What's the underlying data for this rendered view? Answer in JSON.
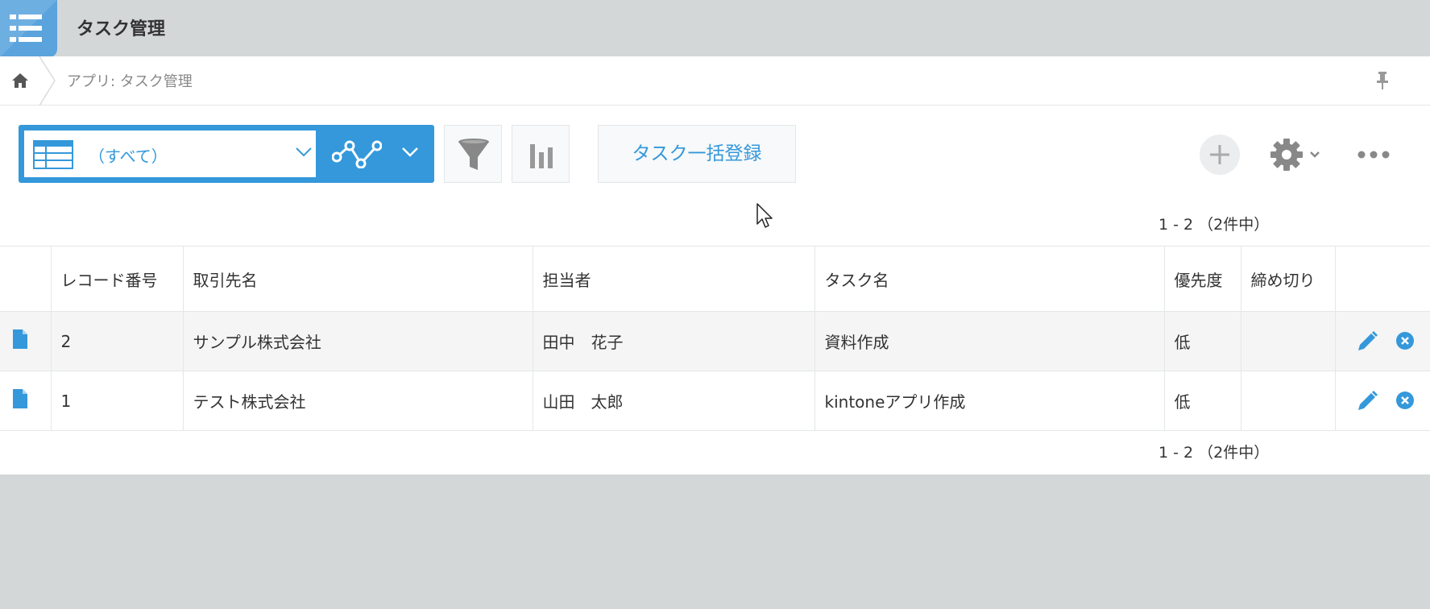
{
  "app": {
    "title": "タスク管理",
    "icon": "app-list-icon",
    "accent_color": "#3498db"
  },
  "breadcrumb": {
    "home_icon": "home-icon",
    "text": "アプリ: タスク管理",
    "pin_icon": "pin-icon"
  },
  "toolbar": {
    "view_label": "（すべて）",
    "view_icon": "table-view-icon",
    "graph_icon": "graph-icon",
    "filter_icon": "filter-icon",
    "chart_icon": "bar-chart-icon",
    "bulk_button_label": "タスク一括登録",
    "add_icon": "plus-icon",
    "settings_icon": "gear-icon",
    "more_icon": "more-icon"
  },
  "pagination": {
    "top": "1 - 2 （2件中）",
    "bottom": "1 - 2 （2件中）"
  },
  "table": {
    "columns": [
      "レコード番号",
      "取引先名",
      "担当者",
      "タスク名",
      "優先度",
      "締め切り"
    ],
    "rows": [
      {
        "record_no": "2",
        "client": "サンプル株式会社",
        "assignee": "田中　花子",
        "task": "資料作成",
        "priority": "低",
        "deadline": ""
      },
      {
        "record_no": "1",
        "client": "テスト株式会社",
        "assignee": "山田　太郎",
        "task": "kintoneアプリ作成",
        "priority": "低",
        "deadline": ""
      }
    ]
  }
}
